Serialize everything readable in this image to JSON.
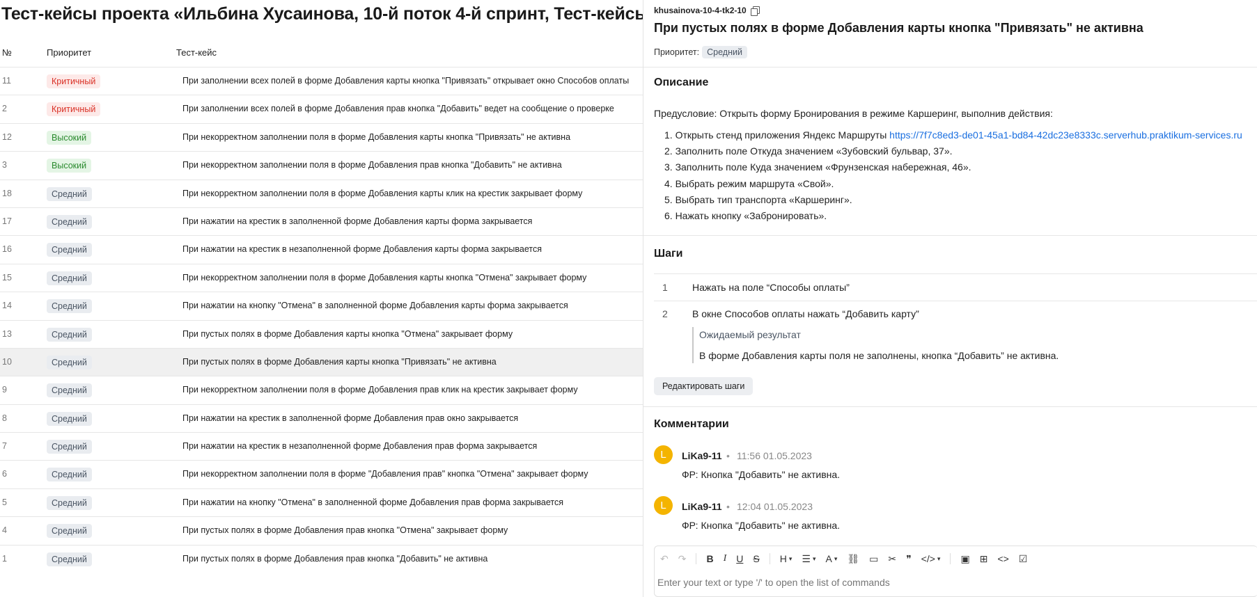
{
  "page_title": "Тест-кейсы проекта «Ильбина Хусаинова, 10-й поток 4-й спринт, Тест-кейсы",
  "table": {
    "headers": {
      "num": "№",
      "priority": "Приоритет",
      "case": "Тест-кейс"
    },
    "rows": [
      {
        "num": "11",
        "priority": "Критичный",
        "level": "crit",
        "title": "При заполнении всех полей в форме Добавления карты кнопка \"Привязать\" открывает окно Способов оплаты"
      },
      {
        "num": "2",
        "priority": "Критичный",
        "level": "crit",
        "title": "При заполнении всех полей в форме Добавления прав кнопка \"Добавить\" ведет на сообщение о проверке"
      },
      {
        "num": "12",
        "priority": "Высокий",
        "level": "high",
        "title": "При некорректном заполнении поля в форме Добавления карты кнопка \"Привязать\" не активна"
      },
      {
        "num": "3",
        "priority": "Высокий",
        "level": "high",
        "title": "При некорректном заполнении поля в форме Добавления прав кнопка \"Добавить\" не активна"
      },
      {
        "num": "18",
        "priority": "Средний",
        "level": "mid",
        "title": "При некорректном заполнении поля в форме Добавления карты клик на крестик закрывает форму"
      },
      {
        "num": "17",
        "priority": "Средний",
        "level": "mid",
        "title": "При нажатии на крестик в заполненной форме Добавления карты форма закрывается"
      },
      {
        "num": "16",
        "priority": "Средний",
        "level": "mid",
        "title": "При нажатии на крестик в незаполненной форме Добавления карты форма закрывается"
      },
      {
        "num": "15",
        "priority": "Средний",
        "level": "mid",
        "title": "При некорректном заполнении поля в форме Добавления карты кнопка \"Отмена\" закрывает форму"
      },
      {
        "num": "14",
        "priority": "Средний",
        "level": "mid",
        "title": "При нажатии на кнопку \"Отмена\" в заполненной форме Добавления карты форма закрывается"
      },
      {
        "num": "13",
        "priority": "Средний",
        "level": "mid",
        "title": "При пустых полях в форме Добавления карты кнопка \"Отмена\" закрывает форму"
      },
      {
        "num": "10",
        "priority": "Средний",
        "level": "mid",
        "selected": true,
        "title": "При пустых полях в форме Добавления карты кнопка \"Привязать\" не активна"
      },
      {
        "num": "9",
        "priority": "Средний",
        "level": "mid",
        "title": "При некорректном заполнении поля в форме Добавления прав клик на крестик закрывает форму"
      },
      {
        "num": "8",
        "priority": "Средний",
        "level": "mid",
        "title": "При нажатии на крестик в заполненной форме Добавления прав окно закрывается"
      },
      {
        "num": "7",
        "priority": "Средний",
        "level": "mid",
        "title": "При нажатии на крестик в незаполненной форме Добавления прав форма закрывается"
      },
      {
        "num": "6",
        "priority": "Средний",
        "level": "mid",
        "title": "При некорректном заполнении поля в форме \"Добавления прав\" кнопка \"Отмена\" закрывает форму"
      },
      {
        "num": "5",
        "priority": "Средний",
        "level": "mid",
        "title": "При нажатии на кнопку \"Отмена\" в заполненной форме Добавления прав форма закрывается"
      },
      {
        "num": "4",
        "priority": "Средний",
        "level": "mid",
        "title": "При пустых полях в форме Добавления прав кнопка \"Отмена\" закрывает форму"
      },
      {
        "num": "1",
        "priority": "Средний",
        "level": "mid",
        "title": "При пустых полях в форме Добавления прав кнопка \"Добавить\" не активна"
      }
    ]
  },
  "detail": {
    "code": "khusainova-10-4-tk2-10",
    "title": "При пустых полях в форме Добавления карты кнопка \"Привязать\" не активна",
    "priority_label": "Приоритет:",
    "priority_value": "Средний",
    "description": {
      "heading": "Описание",
      "precondition": "Предусловие: Открыть форму Бронирования в режиме Каршеринг, выполнив действия:",
      "items": [
        {
          "text": "1. Открыть стенд приложения Яндекс Маршруты ",
          "link": "https://7f7c8ed3-de01-45a1-bd84-42dc23e8333c.serverhub.praktikum-services.ru"
        },
        {
          "text": "2. Заполнить поле Откуда значением «Зубовский бульвар, 37»."
        },
        {
          "text": "3. Заполнить поле Куда значением «Фрунзенская набережная, 46»."
        },
        {
          "text": "4. Выбрать режим маршрута «Свой»."
        },
        {
          "text": "5. Выбрать тип транспорта «Каршеринг»."
        },
        {
          "text": "6. Нажать кнопку «Забронировать»."
        }
      ]
    },
    "steps": {
      "heading": "Шаги",
      "items": [
        {
          "num": "1",
          "text": "Нажать на поле “Способы оплаты”"
        },
        {
          "num": "2",
          "text": "В окне Способов оплаты нажать “Добавить карту”"
        }
      ],
      "expected_label": "Ожидаемый результат",
      "expected_text": "В форме Добавления карты поля не заполнены, кнопка “Добавить” не активна.",
      "edit_button": "Редактировать шаги"
    },
    "comments": {
      "heading": "Комментарии",
      "items": [
        {
          "avatar": "L",
          "author": "LiKa9-11",
          "sep": "•",
          "time": "11:56 01.05.2023",
          "text": "ФР: Кнопка \"Добавить\" не активна."
        },
        {
          "avatar": "L",
          "author": "LiKa9-11",
          "sep": "•",
          "time": "12:04 01.05.2023",
          "text": "ФР: Кнопка \"Добавить\" не активна."
        }
      ]
    },
    "editor": {
      "placeholder": "Enter your text or type '/' to open the list of commands",
      "toolbar": {
        "undo": "↶",
        "redo": "↷",
        "bold": "B",
        "italic": "I",
        "underline": "U",
        "strike": "S",
        "heading": "H",
        "list": "☰",
        "text_color": "A",
        "link": "⛓",
        "note": "▭",
        "cut": "✂",
        "quote": "❞",
        "code_block": "</>",
        "image": "▣",
        "table": "⊞",
        "code": "<>",
        "checkbox": "☑"
      }
    }
  },
  "colors": {
    "crit_bg": "#fde9e8",
    "crit_fg": "#d93025",
    "high_bg": "#e4f5e5",
    "high_fg": "#2a8a2e",
    "mid_bg": "#e9ecf0",
    "mid_fg": "#4a5563",
    "link": "#1a6fe0",
    "avatar": "#f4b400"
  }
}
